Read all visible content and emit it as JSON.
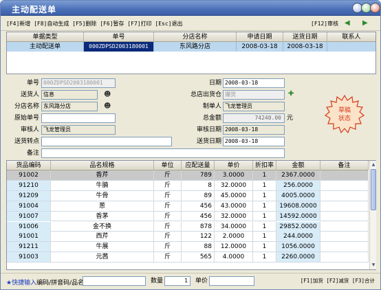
{
  "window": {
    "title": "主动配送单"
  },
  "toolbar": {
    "shortcuts": "[F4]新增 [F8]自动生成 [F5]删除 [F6]暂存 [F7]打印 [Esc]退出",
    "review": "[F12]审核"
  },
  "list": {
    "columns": [
      "单据类型",
      "单号",
      "分店名称",
      "申请日期",
      "送货日期",
      "联系人"
    ],
    "rows": [
      [
        "主动配送单",
        "000ZDPSD2003180001",
        "东风路分店",
        "2008-03-18",
        "2008-03-18",
        ""
      ]
    ]
  },
  "form": {
    "doc_no_label": "单号",
    "doc_no": "000ZDPSD2003180001",
    "date_label": "日期",
    "date": "2008-03-18",
    "sender_label": "送货人",
    "sender": "信息",
    "store_label": "总店出货仓",
    "store": "爆货",
    "branch_label": "分店名称",
    "branch": "东风路分店",
    "maker_label": "制单人",
    "maker": "飞龙管理员",
    "orig_no_label": "原始单号",
    "orig_no": "",
    "total_label": "总金额",
    "total": "74240.00",
    "total_unit": "元",
    "reviewer_label": "审核人",
    "reviewer": "飞龙管理员",
    "review_date_label": "审核日期",
    "review_date": "2008-03-18",
    "delivery_point_label": "送货转点",
    "delivery_point": "",
    "delivery_date_label": "送货日期",
    "delivery_date": "2008-03-18",
    "remark_label": "备注",
    "remark": ""
  },
  "stamp": {
    "line1": "草稿",
    "line2": "状态",
    "color": "#d63a1a"
  },
  "grid": {
    "columns": [
      "货品编码",
      "品名规格",
      "单位",
      "应配送量",
      "单价",
      "折扣率",
      "金额",
      "备注"
    ],
    "rows": [
      [
        "91002",
        "香芹",
        "斤",
        "789",
        "3.0000",
        "1",
        "2367.0000",
        ""
      ],
      [
        "91210",
        "牛腩",
        "斤",
        "8",
        "32.0000",
        "1",
        "256.0000",
        ""
      ],
      [
        "91209",
        "牛骨",
        "斤",
        "89",
        "45.0000",
        "1",
        "4005.0000",
        ""
      ],
      [
        "91004",
        "葱",
        "斤",
        "456",
        "43.0000",
        "1",
        "19608.0000",
        ""
      ],
      [
        "91007",
        "香茅",
        "斤",
        "456",
        "32.0000",
        "1",
        "14592.0000",
        ""
      ],
      [
        "91006",
        "金不换",
        "斤",
        "878",
        "34.0000",
        "1",
        "29852.0000",
        ""
      ],
      [
        "91001",
        "西芹",
        "斤",
        "122",
        "2.0000",
        "1",
        "244.0000",
        ""
      ],
      [
        "91211",
        "牛展",
        "斤",
        "88",
        "12.0000",
        "1",
        "1056.0000",
        ""
      ],
      [
        "91003",
        "元茜",
        "斤",
        "565",
        "4.0000",
        "1",
        "2260.0000",
        ""
      ]
    ]
  },
  "bottom": {
    "quick_label": "★快捷输入",
    "quick_hint": "编码/拼音码/品名",
    "qty_label": "数量",
    "qty": "1",
    "price_label": "单价",
    "price": "",
    "keys": "[F1]加货  [F2]减货  [F3]合计"
  }
}
